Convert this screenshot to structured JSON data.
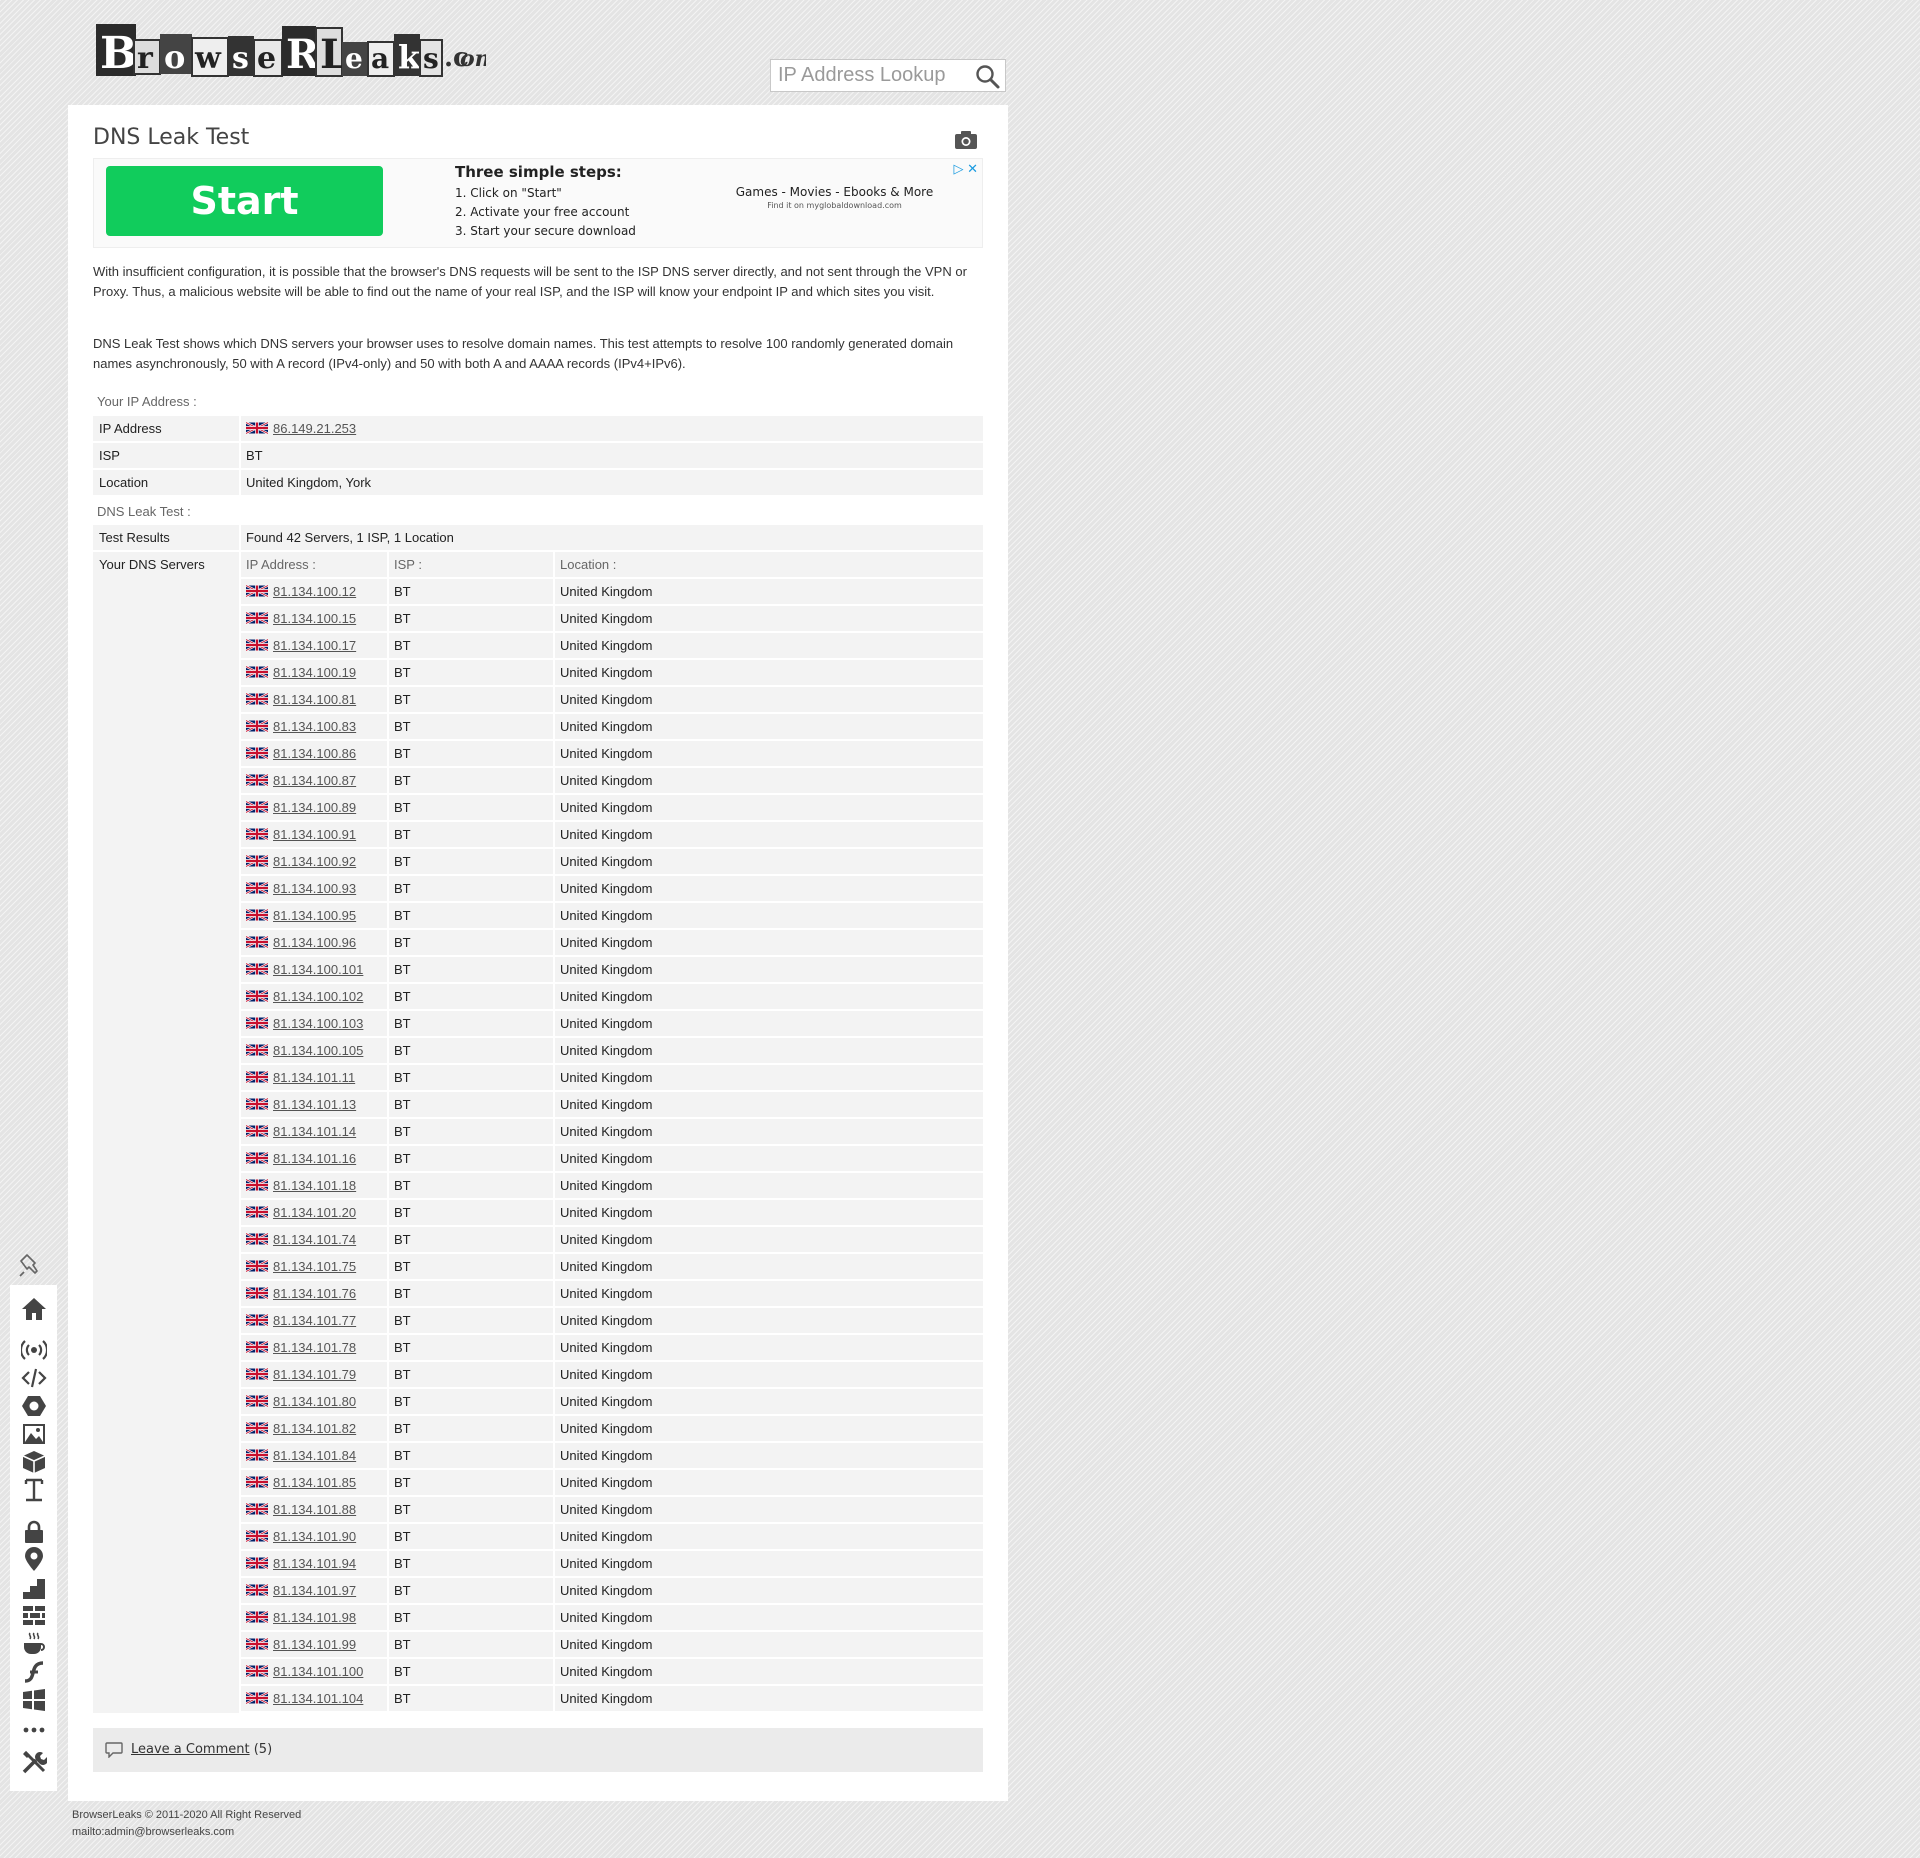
{
  "header": {
    "logo_text": "BrowserLeaks.com",
    "search_placeholder": "IP Address Lookup"
  },
  "page": {
    "title": "DNS Leak Test",
    "intro_1": "With insufficient configuration, it is possible that the browser's DNS requests will be sent to the ISP DNS server directly, and not sent through the VPN or Proxy. Thus, a malicious website will be able to find out the name of your real ISP, and the ISP will know your endpoint IP and which sites you visit.",
    "intro_2": "DNS Leak Test shows which DNS servers your browser uses to resolve domain names. This test attempts to resolve 100 randomly generated domain names asynchronously, 50 with A record (IPv4-only) and 50 with both A and AAAA records (IPv4+IPv6)."
  },
  "ad": {
    "button": "Start",
    "heading": "Three simple steps:",
    "step1": "1. Click on \"Start\"",
    "step2": "2. Activate your free account",
    "step3": "3. Start your secure download",
    "tagline": "Games - Movies - Ebooks & More",
    "subline": "Find it on myglobaldownload.com",
    "choices": "▷ ✕"
  },
  "your_ip": {
    "section_label": "Your IP Address :",
    "rows": [
      {
        "label": "IP Address",
        "value": "86.149.21.253"
      },
      {
        "label": "ISP",
        "value": "BT"
      },
      {
        "label": "Location",
        "value": "United Kingdom, York"
      }
    ]
  },
  "dns_test": {
    "section_label": "DNS Leak Test :",
    "results_label": "Test Results",
    "results_value": "Found 42 Servers, 1 ISP, 1 Location",
    "servers_label": "Your DNS Servers",
    "columns": [
      "IP Address :",
      "ISP :",
      "Location :"
    ],
    "servers": [
      {
        "ip": "81.134.100.12",
        "isp": "BT",
        "location": "United Kingdom"
      },
      {
        "ip": "81.134.100.15",
        "isp": "BT",
        "location": "United Kingdom"
      },
      {
        "ip": "81.134.100.17",
        "isp": "BT",
        "location": "United Kingdom"
      },
      {
        "ip": "81.134.100.19",
        "isp": "BT",
        "location": "United Kingdom"
      },
      {
        "ip": "81.134.100.81",
        "isp": "BT",
        "location": "United Kingdom"
      },
      {
        "ip": "81.134.100.83",
        "isp": "BT",
        "location": "United Kingdom"
      },
      {
        "ip": "81.134.100.86",
        "isp": "BT",
        "location": "United Kingdom"
      },
      {
        "ip": "81.134.100.87",
        "isp": "BT",
        "location": "United Kingdom"
      },
      {
        "ip": "81.134.100.89",
        "isp": "BT",
        "location": "United Kingdom"
      },
      {
        "ip": "81.134.100.91",
        "isp": "BT",
        "location": "United Kingdom"
      },
      {
        "ip": "81.134.100.92",
        "isp": "BT",
        "location": "United Kingdom"
      },
      {
        "ip": "81.134.100.93",
        "isp": "BT",
        "location": "United Kingdom"
      },
      {
        "ip": "81.134.100.95",
        "isp": "BT",
        "location": "United Kingdom"
      },
      {
        "ip": "81.134.100.96",
        "isp": "BT",
        "location": "United Kingdom"
      },
      {
        "ip": "81.134.100.101",
        "isp": "BT",
        "location": "United Kingdom"
      },
      {
        "ip": "81.134.100.102",
        "isp": "BT",
        "location": "United Kingdom"
      },
      {
        "ip": "81.134.100.103",
        "isp": "BT",
        "location": "United Kingdom"
      },
      {
        "ip": "81.134.100.105",
        "isp": "BT",
        "location": "United Kingdom"
      },
      {
        "ip": "81.134.101.11",
        "isp": "BT",
        "location": "United Kingdom"
      },
      {
        "ip": "81.134.101.13",
        "isp": "BT",
        "location": "United Kingdom"
      },
      {
        "ip": "81.134.101.14",
        "isp": "BT",
        "location": "United Kingdom"
      },
      {
        "ip": "81.134.101.16",
        "isp": "BT",
        "location": "United Kingdom"
      },
      {
        "ip": "81.134.101.18",
        "isp": "BT",
        "location": "United Kingdom"
      },
      {
        "ip": "81.134.101.20",
        "isp": "BT",
        "location": "United Kingdom"
      },
      {
        "ip": "81.134.101.74",
        "isp": "BT",
        "location": "United Kingdom"
      },
      {
        "ip": "81.134.101.75",
        "isp": "BT",
        "location": "United Kingdom"
      },
      {
        "ip": "81.134.101.76",
        "isp": "BT",
        "location": "United Kingdom"
      },
      {
        "ip": "81.134.101.77",
        "isp": "BT",
        "location": "United Kingdom"
      },
      {
        "ip": "81.134.101.78",
        "isp": "BT",
        "location": "United Kingdom"
      },
      {
        "ip": "81.134.101.79",
        "isp": "BT",
        "location": "United Kingdom"
      },
      {
        "ip": "81.134.101.80",
        "isp": "BT",
        "location": "United Kingdom"
      },
      {
        "ip": "81.134.101.82",
        "isp": "BT",
        "location": "United Kingdom"
      },
      {
        "ip": "81.134.101.84",
        "isp": "BT",
        "location": "United Kingdom"
      },
      {
        "ip": "81.134.101.85",
        "isp": "BT",
        "location": "United Kingdom"
      },
      {
        "ip": "81.134.101.88",
        "isp": "BT",
        "location": "United Kingdom"
      },
      {
        "ip": "81.134.101.90",
        "isp": "BT",
        "location": "United Kingdom"
      },
      {
        "ip": "81.134.101.94",
        "isp": "BT",
        "location": "United Kingdom"
      },
      {
        "ip": "81.134.101.97",
        "isp": "BT",
        "location": "United Kingdom"
      },
      {
        "ip": "81.134.101.98",
        "isp": "BT",
        "location": "United Kingdom"
      },
      {
        "ip": "81.134.101.99",
        "isp": "BT",
        "location": "United Kingdom"
      },
      {
        "ip": "81.134.101.100",
        "isp": "BT",
        "location": "United Kingdom"
      },
      {
        "ip": "81.134.101.104",
        "isp": "BT",
        "location": "United Kingdom"
      }
    ]
  },
  "comments": {
    "link": "Leave a Comment",
    "count": "(5)"
  },
  "footer": {
    "copyright": "BrowserLeaks © 2011-2020 All Right Reserved",
    "email": "mailto:admin@browserleaks.com"
  },
  "sidebar": {
    "icons": [
      "pin-icon",
      "home-icon",
      "broadcast-icon",
      "code-icon",
      "chrome-icon",
      "image-icon",
      "cube-icon",
      "text-cursor-icon",
      "lock-icon",
      "map-marker-icon",
      "stairs-icon",
      "bricks-icon",
      "coffee-icon",
      "flash-icon",
      "windows-icon",
      "more-icon",
      "tools-icon"
    ]
  },
  "colors": {
    "accent_green": "#11cc5c",
    "panel_bg": "#ffffff",
    "row_bg": "#f3f3f3"
  }
}
